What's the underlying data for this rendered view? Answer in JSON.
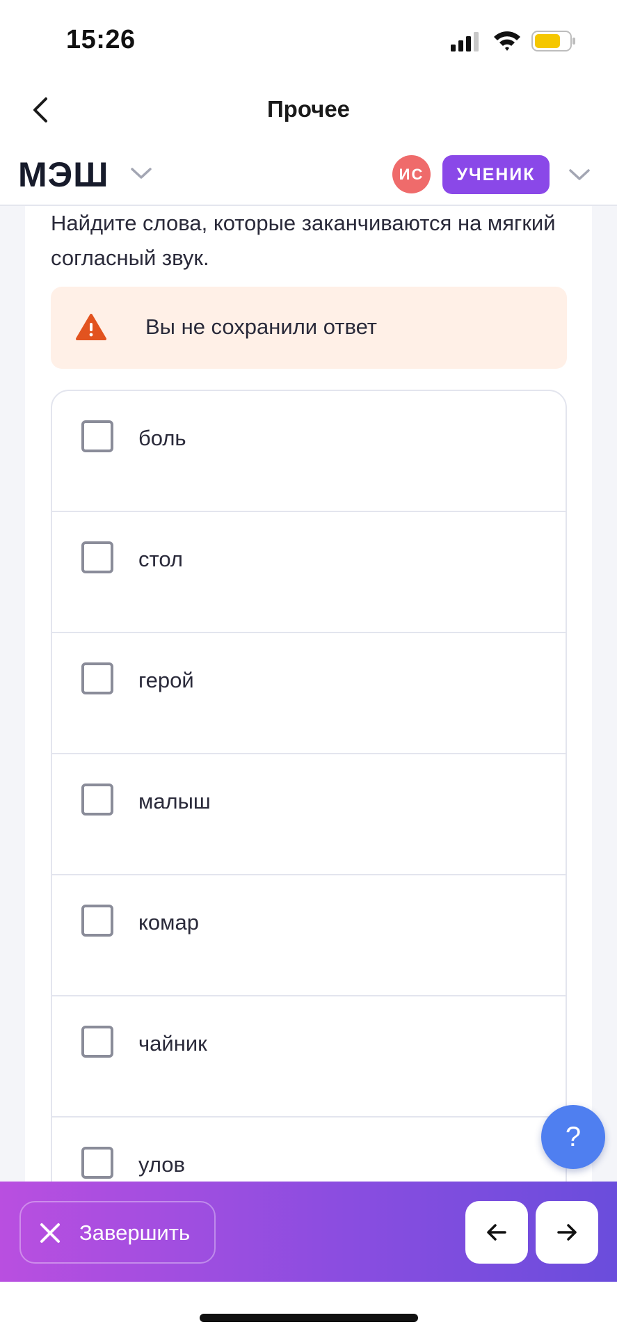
{
  "status_bar": {
    "time": "15:26"
  },
  "nav": {
    "title": "Прочее"
  },
  "brand": {
    "logo": "МЭШ",
    "avatar_initials": "ИС",
    "role": "УЧЕНИК"
  },
  "question": {
    "text": "Найдите слова, которые заканчиваются на мягкий согласный звук.",
    "alert": "Вы не сохранили ответ"
  },
  "options": [
    {
      "label": "боль",
      "checked": false
    },
    {
      "label": "стол",
      "checked": false
    },
    {
      "label": "герой",
      "checked": false
    },
    {
      "label": "малыш",
      "checked": false
    },
    {
      "label": "комар",
      "checked": false
    },
    {
      "label": "чайник",
      "checked": false
    },
    {
      "label": "улов",
      "checked": false
    }
  ],
  "help": {
    "label": "?"
  },
  "footer": {
    "finish_label": "Завершить"
  },
  "colors": {
    "role_badge": "#8a48e8",
    "avatar": "#ef6b6b",
    "alert_bg": "#fff0e7",
    "alert_icon": "#e2531f",
    "help_fab": "#4f7ff0",
    "bar_gradient_start": "#b94fe0",
    "bar_gradient_end": "#6a4ddc",
    "battery": "#f5c700"
  },
  "icons": {
    "back": "chevron-left-icon",
    "brand_menu": "chevron-down-icon",
    "role_menu": "chevron-down-icon",
    "alert": "warning-icon",
    "finish": "close-icon",
    "prev": "arrow-left-icon",
    "next": "arrow-right-icon"
  }
}
